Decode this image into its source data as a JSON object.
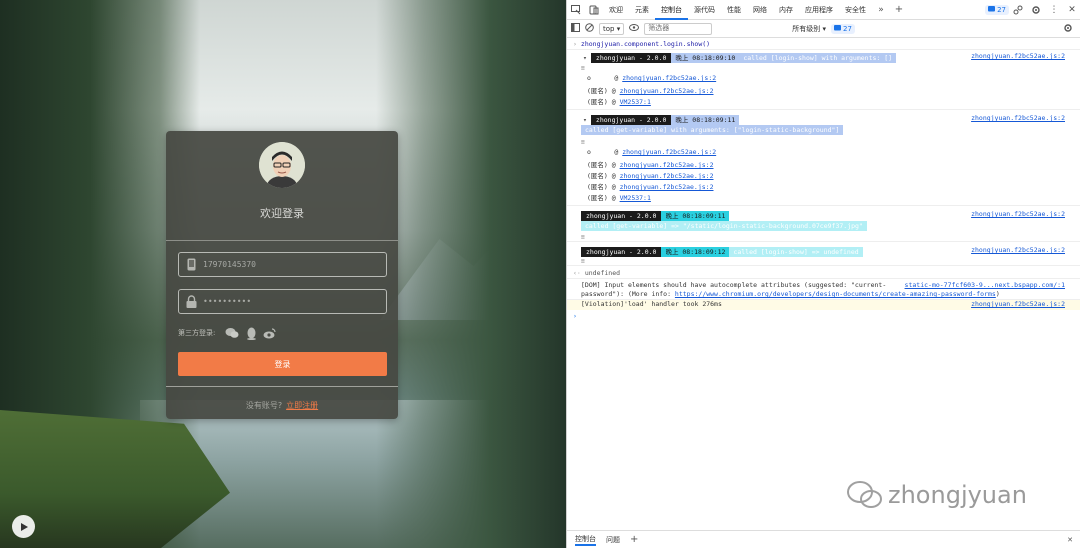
{
  "login": {
    "title": "欢迎登录",
    "phone_placeholder": "17970145370",
    "password_placeholder": "••••••••••",
    "third_party_label": "第三方登录:",
    "login_button": "登录",
    "no_account": "没有账号?",
    "register_link": "立即注册"
  },
  "devtools": {
    "tabs": [
      "欢迎",
      "元素",
      "控制台",
      "源代码",
      "性能",
      "网络",
      "内存",
      "应用程序",
      "安全性"
    ],
    "active_tab": "控制台",
    "issues_count": "27",
    "context": "top",
    "filter_placeholder": "筛选器",
    "levels": "所有级别",
    "levels_count": "27",
    "bottom_tabs": [
      "控制台",
      "问题"
    ],
    "console": {
      "command": "zhongjyuan.component.login.show()",
      "group1": {
        "tag": "zhongjyuan - 2.0.0",
        "time": "晚上 08:18:09:10",
        "msg": "called [login-show] with arguments: []",
        "src": "zhongjyuan.f2bc52ae.js:2",
        "stack": [
          {
            "prefix": "",
            "link": "zhongjyuan.f2bc52ae.js:2"
          },
          {
            "prefix": "(匿名) @",
            "link": "zhongjyuan.f2bc52ae.js:2"
          },
          {
            "prefix": "(匿名) @",
            "link": "VM2537:1"
          }
        ]
      },
      "group2": {
        "tag": "zhongjyuan - 2.0.0",
        "time": "晚上 08:18:09:11",
        "msg": "called [get-variable] with arguments: [\"login-static-background\"]",
        "src": "zhongjyuan.f2bc52ae.js:2",
        "stack": [
          {
            "prefix": "",
            "link": "zhongjyuan.f2bc52ae.js:2"
          },
          {
            "prefix": "(匿名) @",
            "link": "zhongjyuan.f2bc52ae.js:2"
          },
          {
            "prefix": "(匿名) @",
            "link": "zhongjyuan.f2bc52ae.js:2"
          },
          {
            "prefix": "(匿名) @",
            "link": "zhongjyuan.f2bc52ae.js:2"
          },
          {
            "prefix": "(匿名) @",
            "link": "VM2537:1"
          }
        ]
      },
      "line3": {
        "tag": "zhongjyuan - 2.0.0",
        "time": "晚上 08:18:09:11",
        "msg": "called [get-variable] => \"/static/login-static-background.07ce9f37.jpg\"",
        "src": "zhongjyuan.f2bc52ae.js:2"
      },
      "line4": {
        "tag": "zhongjyuan - 2.0.0",
        "time": "晚上 08:18:09:12",
        "msg": "called [login-show] => undefined",
        "src": "zhongjyuan.f2bc52ae.js:2"
      },
      "result": "undefined",
      "dom_msg_1": "[DOM] Input elements should have autocomplete attributes (suggested: \"current-",
      "dom_msg_2": "password\"): (More info: ",
      "dom_link": "https://www.chromium.org/developers/design-documents/create-amazing-password-forms",
      "dom_src": "static-mo-77fcf603-9...next.bspapp.com/:1",
      "violation": "[Violation]'load' handler took 276ms",
      "violation_src": "zhongjyuan.f2bc52ae.js:2"
    }
  },
  "watermark": "zhongjyuan"
}
